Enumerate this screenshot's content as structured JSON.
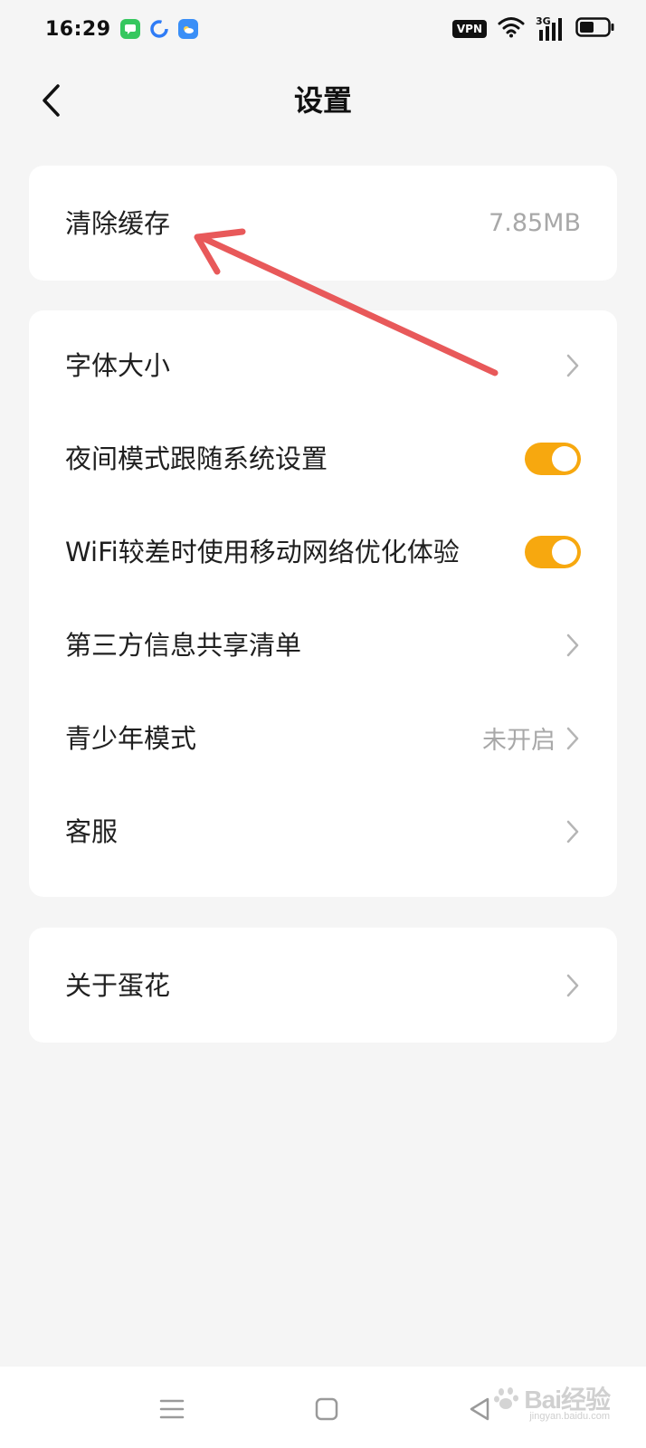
{
  "status_bar": {
    "time": "16:29",
    "vpn": "VPN",
    "network": "3G"
  },
  "header": {
    "title": "设置"
  },
  "cache_card": {
    "label": "清除缓存",
    "value": "7.85MB"
  },
  "settings_card": {
    "font_size": {
      "label": "字体大小"
    },
    "night_mode": {
      "label": "夜间模式跟随系统设置",
      "enabled": true
    },
    "wifi_optimize": {
      "label": "WiFi较差时使用移动网络优化体验",
      "enabled": true
    },
    "third_party": {
      "label": "第三方信息共享清单"
    },
    "teen_mode": {
      "label": "青少年模式",
      "value": "未开启"
    },
    "service": {
      "label": "客服"
    }
  },
  "about_card": {
    "label": "关于蛋花"
  },
  "watermark": {
    "brand": "Bai经验",
    "url": "jingyan.baidu.com"
  },
  "colors": {
    "accent_toggle": "#f7a80f",
    "annotation_arrow": "#e8595a",
    "background": "#f5f5f5"
  }
}
